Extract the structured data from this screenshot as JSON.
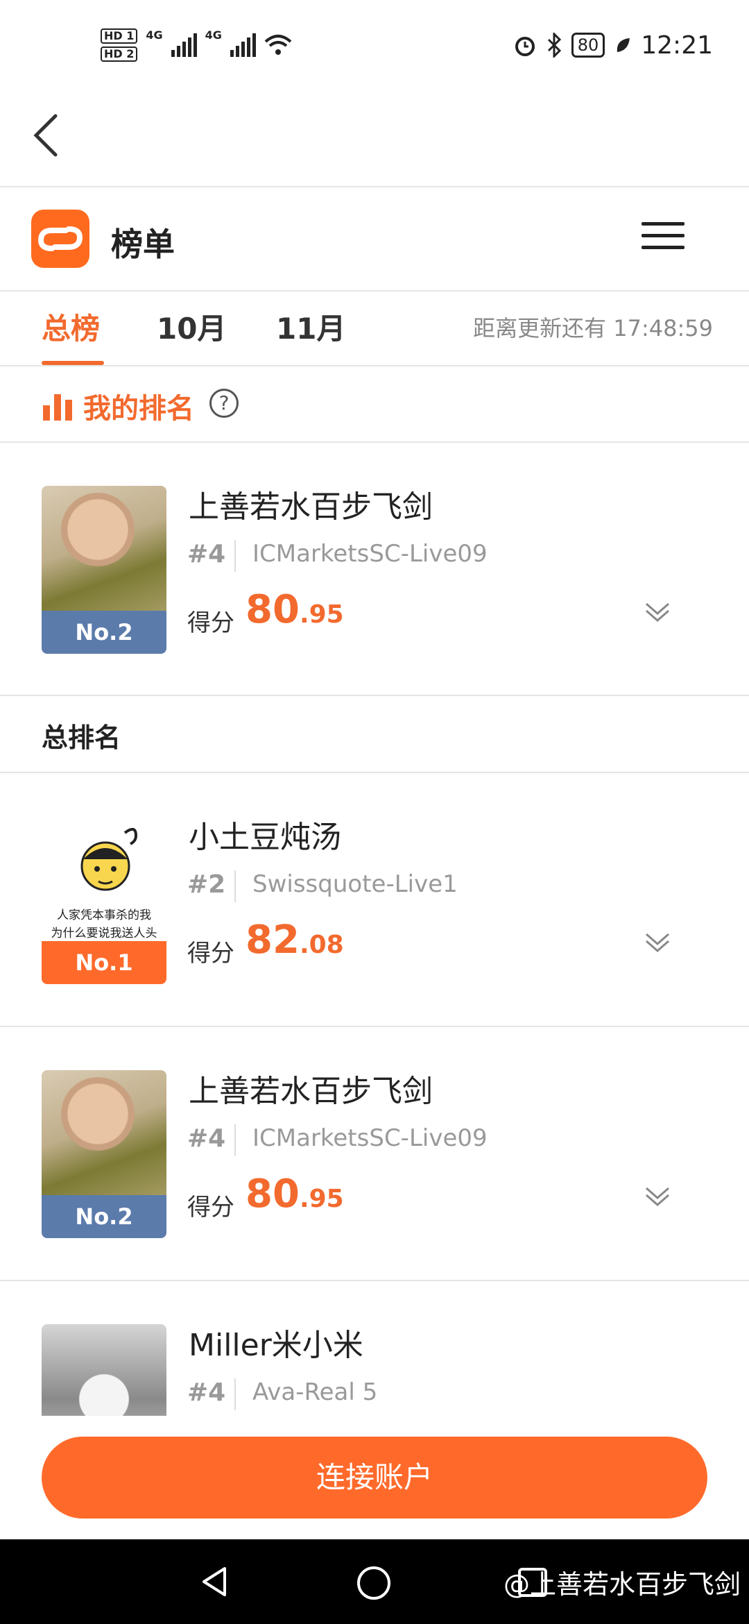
{
  "status_bar": {
    "hd1": "HD 1",
    "hd2": "HD 2",
    "net1": "4G",
    "net2": "4G",
    "battery": "80",
    "time": "12:21"
  },
  "header": {
    "title": "榜单"
  },
  "tabs": [
    {
      "label": "总榜",
      "active": true
    },
    {
      "label": "10月",
      "active": false
    },
    {
      "label": "11月",
      "active": false
    }
  ],
  "countdown": "距离更新还有 17:48:59",
  "my_rank": {
    "label": "我的排名",
    "help": "?",
    "entry": {
      "badge": "No.2",
      "name": "上善若水百步飞剑",
      "rank": "#4",
      "server": "ICMarketsSC-Live09",
      "score_label": "得分",
      "score_int": "80",
      "score_dec": ".95"
    }
  },
  "overall": {
    "title": "总排名",
    "entries": [
      {
        "badge": "No.1",
        "name": "小土豆炖汤",
        "rank": "#2",
        "server": "Swissquote-Live1",
        "score_label": "得分",
        "score_int": "82",
        "score_dec": ".08",
        "avatar_text_1": "人家凭本事杀的我",
        "avatar_text_2": "为什么要说我送人头"
      },
      {
        "badge": "No.2",
        "name": "上善若水百步飞剑",
        "rank": "#4",
        "server": "ICMarketsSC-Live09",
        "score_label": "得分",
        "score_int": "80",
        "score_dec": ".95"
      },
      {
        "name": "Miller米小米",
        "rank": "#4",
        "server": "Ava-Real 5"
      }
    ]
  },
  "connect_button": "连接账户",
  "watermark": "@上善若水百步飞剑",
  "colors": {
    "accent": "#f26a2e",
    "badge_blue": "#5b7bab"
  }
}
